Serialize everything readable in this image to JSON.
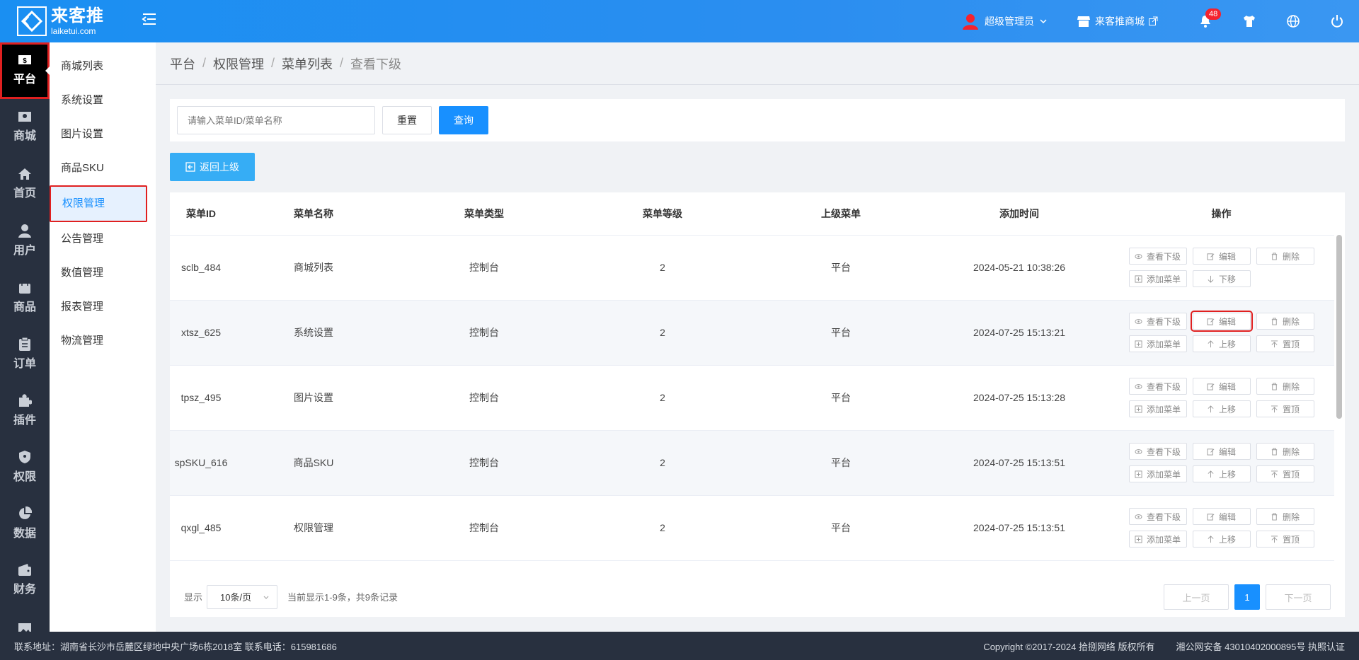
{
  "header": {
    "logo_cn": "来客推",
    "logo_en": "laiketui.com",
    "user_name": "超级管理员",
    "shop_name": "来客推商城",
    "notification_count": "48"
  },
  "leftnav": [
    {
      "label": "平台",
      "icon": "platform-icon"
    },
    {
      "label": "商城",
      "icon": "store-icon"
    },
    {
      "label": "首页",
      "icon": "home-icon"
    },
    {
      "label": "用户",
      "icon": "user-icon"
    },
    {
      "label": "商品",
      "icon": "bag-icon"
    },
    {
      "label": "订单",
      "icon": "clipboard-icon"
    },
    {
      "label": "插件",
      "icon": "puzzle-icon"
    },
    {
      "label": "权限",
      "icon": "shield-icon"
    },
    {
      "label": "数据",
      "icon": "pie-chart-icon"
    },
    {
      "label": "财务",
      "icon": "wallet-icon"
    }
  ],
  "submenu": [
    "商城列表",
    "系统设置",
    "图片设置",
    "商品SKU",
    "权限管理",
    "公告管理",
    "数值管理",
    "报表管理",
    "物流管理"
  ],
  "breadcrumb": [
    "平台",
    "权限管理",
    "菜单列表",
    "查看下级"
  ],
  "search": {
    "placeholder": "请输入菜单ID/菜单名称",
    "reset_label": "重置",
    "query_label": "查询"
  },
  "back_label": "返回上级",
  "table": {
    "columns": [
      "菜单ID",
      "菜单名称",
      "菜单类型",
      "菜单等级",
      "上级菜单",
      "添加时间",
      "操作"
    ],
    "rows": [
      {
        "id": "sclb_484",
        "name": "商城列表",
        "type": "控制台",
        "level": "2",
        "parent": "平台",
        "time": "2024-05-21 10:38:26",
        "ops": [
          "查看下级",
          "编辑",
          "删除",
          "添加菜单",
          "下移"
        ]
      },
      {
        "id": "xtsz_625",
        "name": "系统设置",
        "type": "控制台",
        "level": "2",
        "parent": "平台",
        "time": "2024-07-25 15:13:21",
        "ops": [
          "查看下级",
          "编辑",
          "删除",
          "添加菜单",
          "上移",
          "置顶"
        ]
      },
      {
        "id": "tpsz_495",
        "name": "图片设置",
        "type": "控制台",
        "level": "2",
        "parent": "平台",
        "time": "2024-07-25 15:13:28",
        "ops": [
          "查看下级",
          "编辑",
          "删除",
          "添加菜单",
          "上移",
          "置顶"
        ]
      },
      {
        "id": "spSKU_616",
        "name": "商品SKU",
        "type": "控制台",
        "level": "2",
        "parent": "平台",
        "time": "2024-07-25 15:13:51",
        "ops": [
          "查看下级",
          "编辑",
          "删除",
          "添加菜单",
          "上移",
          "置顶"
        ]
      },
      {
        "id": "qxgl_485",
        "name": "权限管理",
        "type": "控制台",
        "level": "2",
        "parent": "平台",
        "time": "2024-07-25 15:13:51",
        "ops": [
          "查看下级",
          "编辑",
          "删除",
          "添加菜单",
          "上移",
          "置顶"
        ]
      }
    ]
  },
  "pager": {
    "show_label": "显示",
    "per_page": "10条/页",
    "summary": "当前显示1-9条，共9条记录",
    "prev": "上一页",
    "current": "1",
    "next": "下一页"
  },
  "footer": {
    "address": "联系地址：湖南省长沙市岳麓区绿地中央广场6栋2018室 联系电话：615981686",
    "copyright": "Copyright ©2017-2024 拾捌网络 版权所有",
    "icp": "湘公网安备 43010402000895号 执照认证"
  }
}
